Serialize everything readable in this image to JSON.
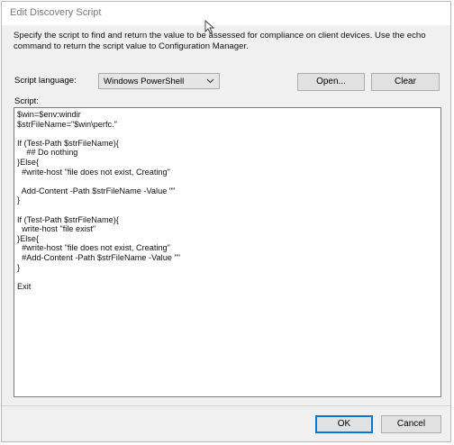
{
  "window": {
    "title": "Edit Discovery Script"
  },
  "description": "Specify the script to find and return the value to be assessed for compliance on client devices. Use the echo command to return the script value to Configuration Manager.",
  "language": {
    "label": "Script language:",
    "selected": "Windows PowerShell"
  },
  "buttons": {
    "open": "Open...",
    "clear": "Clear",
    "ok": "OK",
    "cancel": "Cancel"
  },
  "script": {
    "label": "Script:",
    "lines": [
      "$win=$env:windir",
      "$strFileName=\"$win\\perfc.\"",
      "",
      "If (Test-Path $strFileName){",
      "    ## Do nothing",
      "}Else{",
      "  #write-host \"file does not exist, Creating\"",
      "",
      "  Add-Content -Path $strFileName -Value \"\"",
      "}",
      "",
      "If (Test-Path $strFileName){",
      "  write-host \"file exist\"",
      "}Else{",
      "  #write-host \"file does not exist, Creating\"",
      "  #Add-Content -Path $strFileName -Value \"\"",
      "}",
      "",
      "Exit"
    ]
  }
}
